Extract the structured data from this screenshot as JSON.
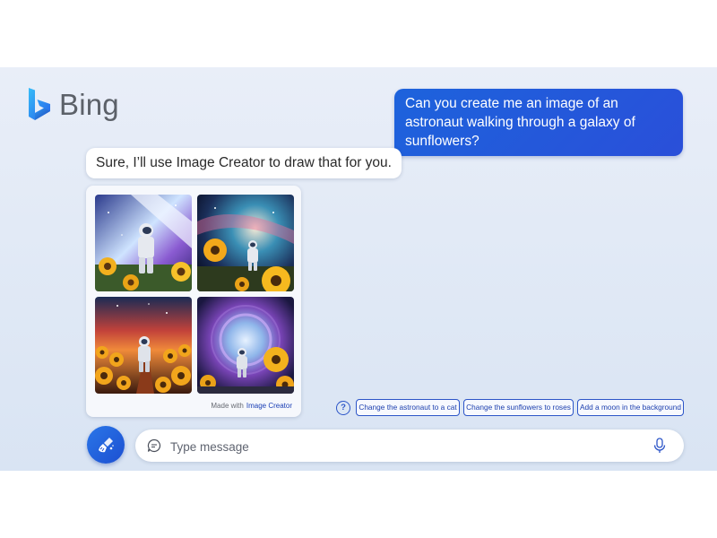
{
  "brand": {
    "name": "Bing",
    "icon": "bing-logo-icon",
    "text_color": "#5c6169"
  },
  "conversation": {
    "user_message": "Can you create me an image of an astronaut walking through a galaxy of sunflowers?",
    "bot_message": "Sure, I’ll use Image Creator to draw that for you."
  },
  "image_card": {
    "images": [
      {
        "alt": "astronaut-image-1"
      },
      {
        "alt": "astronaut-image-2"
      },
      {
        "alt": "astronaut-image-3"
      },
      {
        "alt": "astronaut-image-4"
      }
    ],
    "credit_prefix": "Made with",
    "credit_link": "Image Creator"
  },
  "suggestions": {
    "help_icon": "question-icon",
    "chips": [
      {
        "label": "Change the astronaut to a cat"
      },
      {
        "label": "Change the sunflowers to roses"
      },
      {
        "label": "Add a moon in the background"
      }
    ]
  },
  "composer": {
    "new_topic_icon": "broom-icon",
    "placeholder": "Type message",
    "chat_icon": "chat-bubble-icon",
    "mic_icon": "microphone-icon"
  },
  "colors": {
    "accent": "#1d63dc",
    "chip_border": "#2c55c8",
    "background": "#e2eaf6"
  }
}
